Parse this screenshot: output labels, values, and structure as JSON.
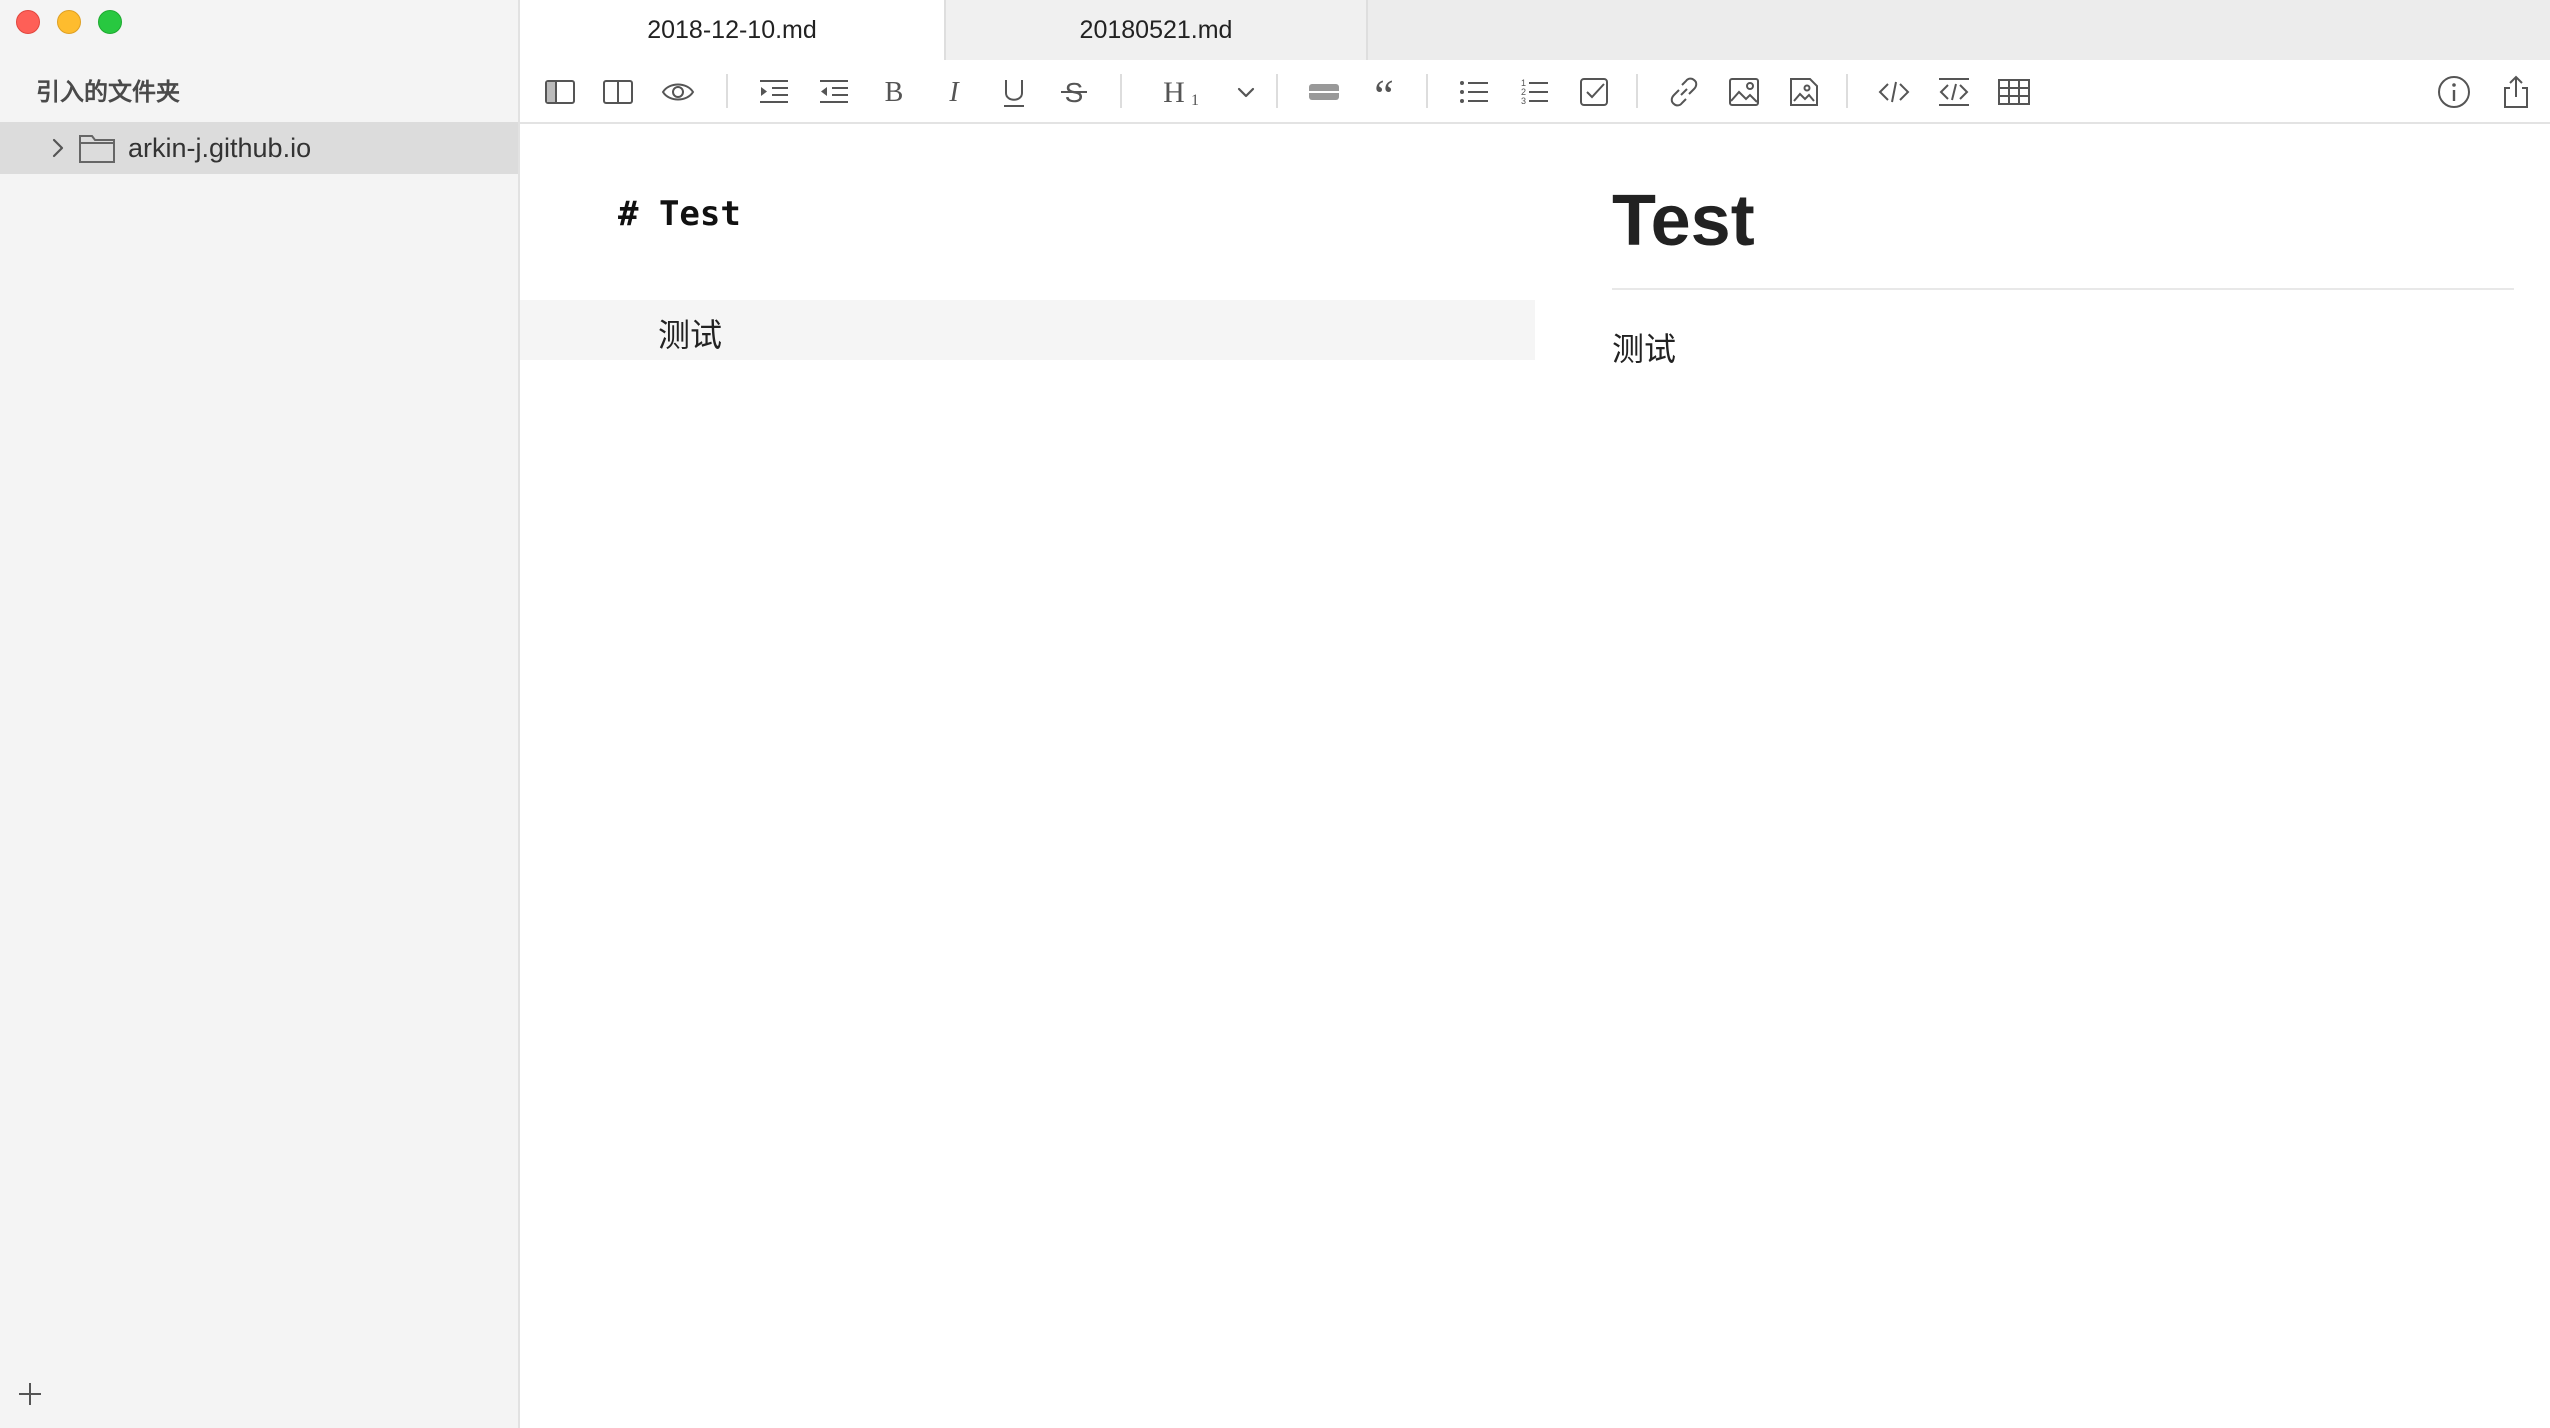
{
  "window": {
    "controls": {
      "close": "close",
      "minimize": "minimize",
      "zoom": "zoom"
    }
  },
  "sidebar": {
    "title": "引入的文件夹",
    "items": [
      {
        "label": "arkin-j.github.io",
        "icon": "folder-icon",
        "expanded": false,
        "selected": true
      }
    ],
    "add_icon": "plus-icon"
  },
  "tabs": [
    {
      "label": "2018-12-10.md",
      "active": true
    },
    {
      "label": "20180521.md",
      "active": false
    }
  ],
  "toolbar": {
    "buttons": [
      "toggle-sidebar-icon",
      "split-view-icon",
      "preview-icon",
      "indent-icon",
      "outdent-icon",
      "bold-icon",
      "italic-icon",
      "underline-icon",
      "strikethrough-icon",
      "heading-icon",
      "heading-dropdown-icon",
      "horizontal-rule-icon",
      "quote-icon",
      "bulleted-list-icon",
      "numbered-list-icon",
      "task-list-icon",
      "link-icon",
      "image-icon",
      "image-upload-icon",
      "inline-code-icon",
      "code-block-icon",
      "table-icon",
      "info-icon",
      "share-icon"
    ]
  },
  "editor": {
    "line1": "# Test",
    "line2": "测试"
  },
  "preview": {
    "heading": "Test",
    "paragraph": "测试"
  }
}
